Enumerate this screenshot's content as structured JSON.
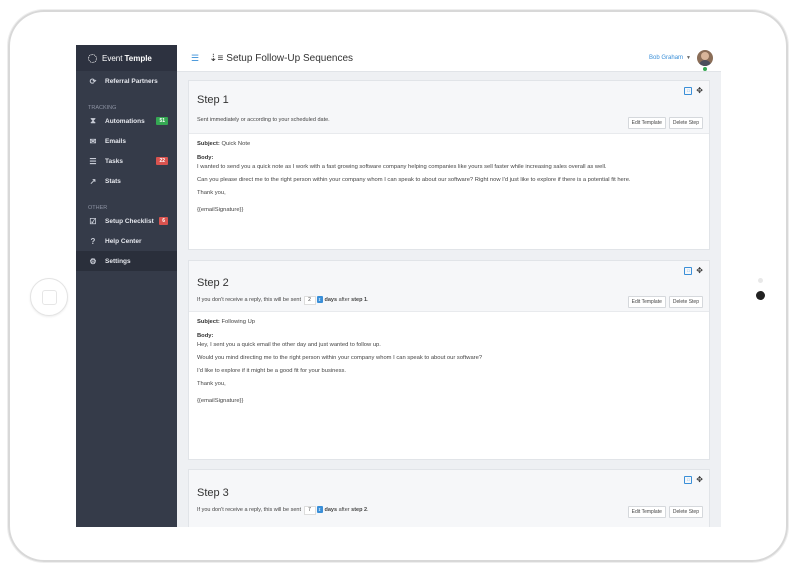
{
  "sidebar": {
    "brand_light": "Event",
    "brand_bold": "Temple",
    "top_items": [
      {
        "label": "Referral Partners",
        "icon": "refresh-icon"
      }
    ],
    "tracking_label": "TRACKING",
    "tracking_items": [
      {
        "label": "Automations",
        "badge": "51",
        "badge_color": "#35a853",
        "icon": "hourglass-icon"
      },
      {
        "label": "Emails",
        "icon": "envelope-icon"
      },
      {
        "label": "Tasks",
        "badge": "22",
        "badge_color": "#d9534f",
        "icon": "list-icon"
      },
      {
        "label": "Stats",
        "icon": "chart-icon"
      }
    ],
    "other_label": "OTHER",
    "other_items": [
      {
        "label": "Setup Checklist",
        "badge": "6",
        "badge_color": "#d9534f",
        "icon": "checkbox-icon"
      },
      {
        "label": "Help Center",
        "icon": "question-icon"
      },
      {
        "label": "Settings",
        "icon": "gears-icon",
        "active": true
      }
    ]
  },
  "header": {
    "title": "Setup Follow-Up Sequences",
    "user_name": "Bob Graham"
  },
  "steps": [
    {
      "title": "Step 1",
      "subtitle": "Sent immediately or according to your scheduled date.",
      "edit_label": "Edit Template",
      "delete_label": "Delete Step",
      "subject_label": "Subject:",
      "subject": "Quick Note",
      "body_label": "Body:",
      "body": [
        "I wanted to send you a quick note as I work with a fast growing software company helping companies like yours sell faster while increasing sales overall as well.",
        "Can you please direct me to the right person within your company whom I can speak to about our software? Right now I'd just like to explore if there is a potential fit here.",
        "Thank you,",
        "{{emailSignature}}"
      ]
    },
    {
      "title": "Step 2",
      "pre": "If you don't receive a reply, this will be sent",
      "days": "2",
      "days_label": "days",
      "after": "after",
      "ref": "step 1",
      "end": ".",
      "edit_label": "Edit Template",
      "delete_label": "Delete Step",
      "subject_label": "Subject:",
      "subject": "Following Up",
      "body_label": "Body:",
      "body": [
        "Hey, I sent you a quick email the other day and just wanted to follow up.",
        "Would you mind directing me to the right person within your company whom I can speak to about our software?",
        "I'd like to explore if it might be a good fit for your business.",
        "Thank you,",
        "{{emailSignature}}"
      ]
    },
    {
      "title": "Step 3",
      "pre": "If you don't receive a reply, this will be sent",
      "days": "7",
      "days_label": "days",
      "after": "after",
      "ref": "step 2",
      "end": ".",
      "edit_label": "Edit Template",
      "delete_label": "Delete Step"
    }
  ]
}
